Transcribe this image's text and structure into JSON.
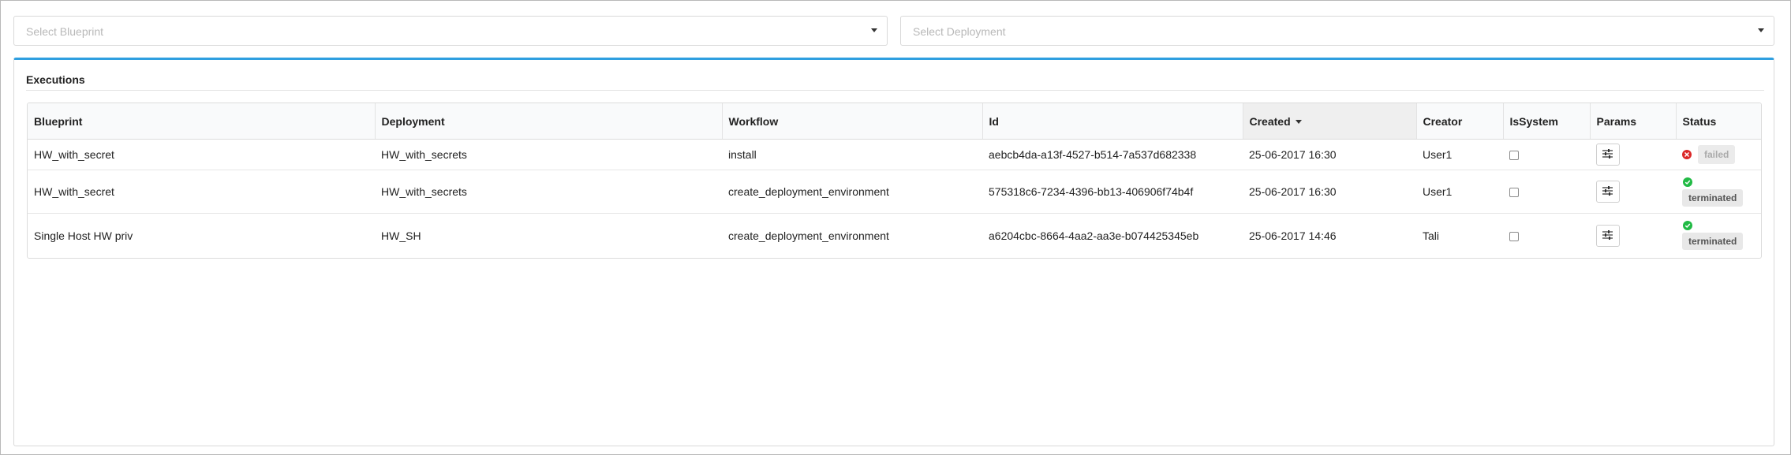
{
  "filters": {
    "blueprint_placeholder": "Select Blueprint",
    "deployment_placeholder": "Select Deployment"
  },
  "widget": {
    "title": "Executions"
  },
  "table": {
    "columns": [
      "Blueprint",
      "Deployment",
      "Workflow",
      "Id",
      "Created",
      "Creator",
      "IsSystem",
      "Params",
      "Status"
    ],
    "sorted_column": "Created",
    "sort_direction": "descending",
    "rows": [
      {
        "blueprint": "HW_with_secret",
        "deployment": "HW_with_secrets",
        "workflow": "install",
        "id": "aebcb4da-a13f-4527-b514-7a537d682338",
        "created": "25-06-2017 16:30",
        "creator": "User1",
        "is_system": false,
        "status": "failed",
        "status_icon": "error-circle-icon"
      },
      {
        "blueprint": "HW_with_secret",
        "deployment": "HW_with_secrets",
        "workflow": "create_deployment_environment",
        "id": "575318c6-7234-4396-bb13-406906f74b4f",
        "created": "25-06-2017 16:30",
        "creator": "User1",
        "is_system": false,
        "status": "terminated",
        "status_icon": "check-circle-icon"
      },
      {
        "blueprint": "Single Host HW priv",
        "deployment": "HW_SH",
        "workflow": "create_deployment_environment",
        "id": "a6204cbc-8664-4aa2-aa3e-b074425345eb",
        "created": "25-06-2017 14:46",
        "creator": "Tali",
        "is_system": false,
        "status": "terminated",
        "status_icon": "check-circle-icon"
      }
    ]
  },
  "colors": {
    "accent": "#2f9fe0",
    "status_failed": "#db2828",
    "status_ok": "#21ba45"
  }
}
